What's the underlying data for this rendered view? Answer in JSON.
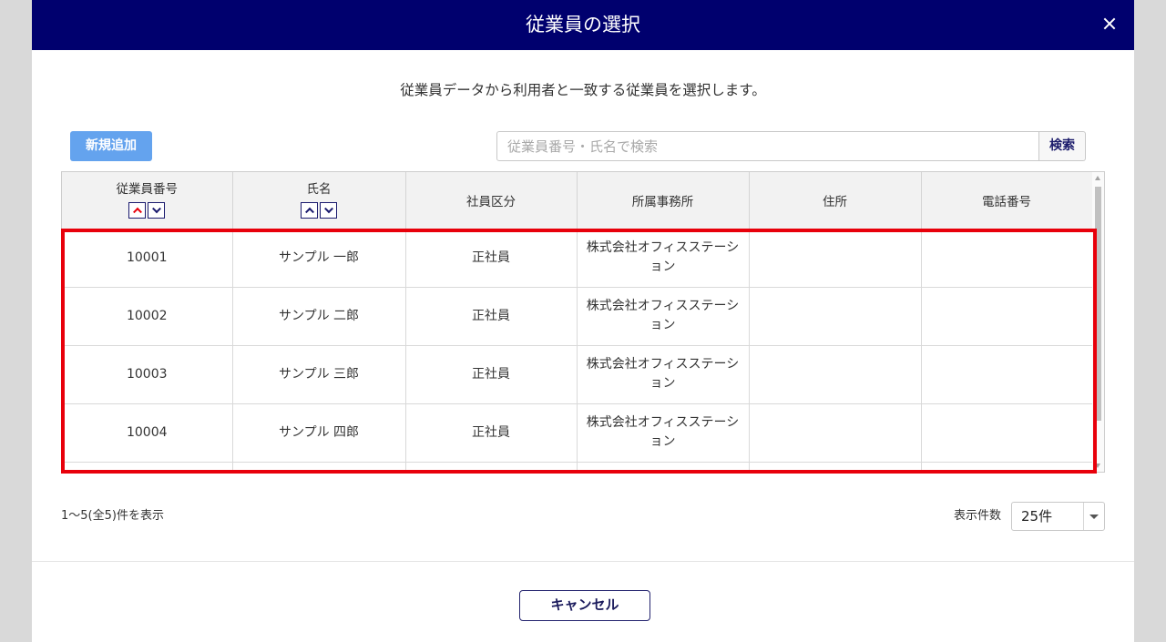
{
  "dialog": {
    "title": "従業員の選択",
    "description": "従業員データから利用者と一致する従業員を選択します。"
  },
  "toolbar": {
    "add_label": "新規追加",
    "search": {
      "placeholder": "従業員番号・氏名で検索",
      "value": ""
    },
    "search_label": "検索"
  },
  "table": {
    "columns": [
      {
        "label": "従業員番号",
        "sortable": true,
        "sort_active": "asc"
      },
      {
        "label": "氏名",
        "sortable": true
      },
      {
        "label": "社員区分"
      },
      {
        "label": "所属事務所"
      },
      {
        "label": "住所"
      },
      {
        "label": "電話番号"
      }
    ],
    "rows": [
      {
        "employee_number": "10001",
        "name": "サンプル 一郎",
        "employment_type": "正社員",
        "office": "株式会社オフィスステーション",
        "address": "",
        "phone": ""
      },
      {
        "employee_number": "10002",
        "name": "サンプル 二郎",
        "employment_type": "正社員",
        "office": "株式会社オフィスステーション",
        "address": "",
        "phone": ""
      },
      {
        "employee_number": "10003",
        "name": "サンプル 三郎",
        "employment_type": "正社員",
        "office": "株式会社オフィスステーション",
        "address": "",
        "phone": ""
      },
      {
        "employee_number": "10004",
        "name": "サンプル 四郎",
        "employment_type": "正社員",
        "office": "株式会社オフィスステーション",
        "address": "",
        "phone": ""
      }
    ]
  },
  "pagination": {
    "summary": "1～5(全5)件を表示",
    "page_size_label": "表示件数",
    "page_size": {
      "value": "25件"
    }
  },
  "footer": {
    "cancel_label": "キャンセル"
  },
  "icons": {
    "close": "close-icon",
    "sort_asc": "chevron-up-icon",
    "sort_desc": "chevron-down-icon",
    "select_arrow": "caret-down-icon",
    "scroll_up": "scroll-up-icon",
    "scroll_down": "scroll-down-icon"
  },
  "colors": {
    "header_bg": "#00006e",
    "highlight_border": "#e8000b",
    "add_button_bg": "#64a3ee",
    "sort_active": "#e8000b",
    "page_bg": "#d9d9d9"
  }
}
